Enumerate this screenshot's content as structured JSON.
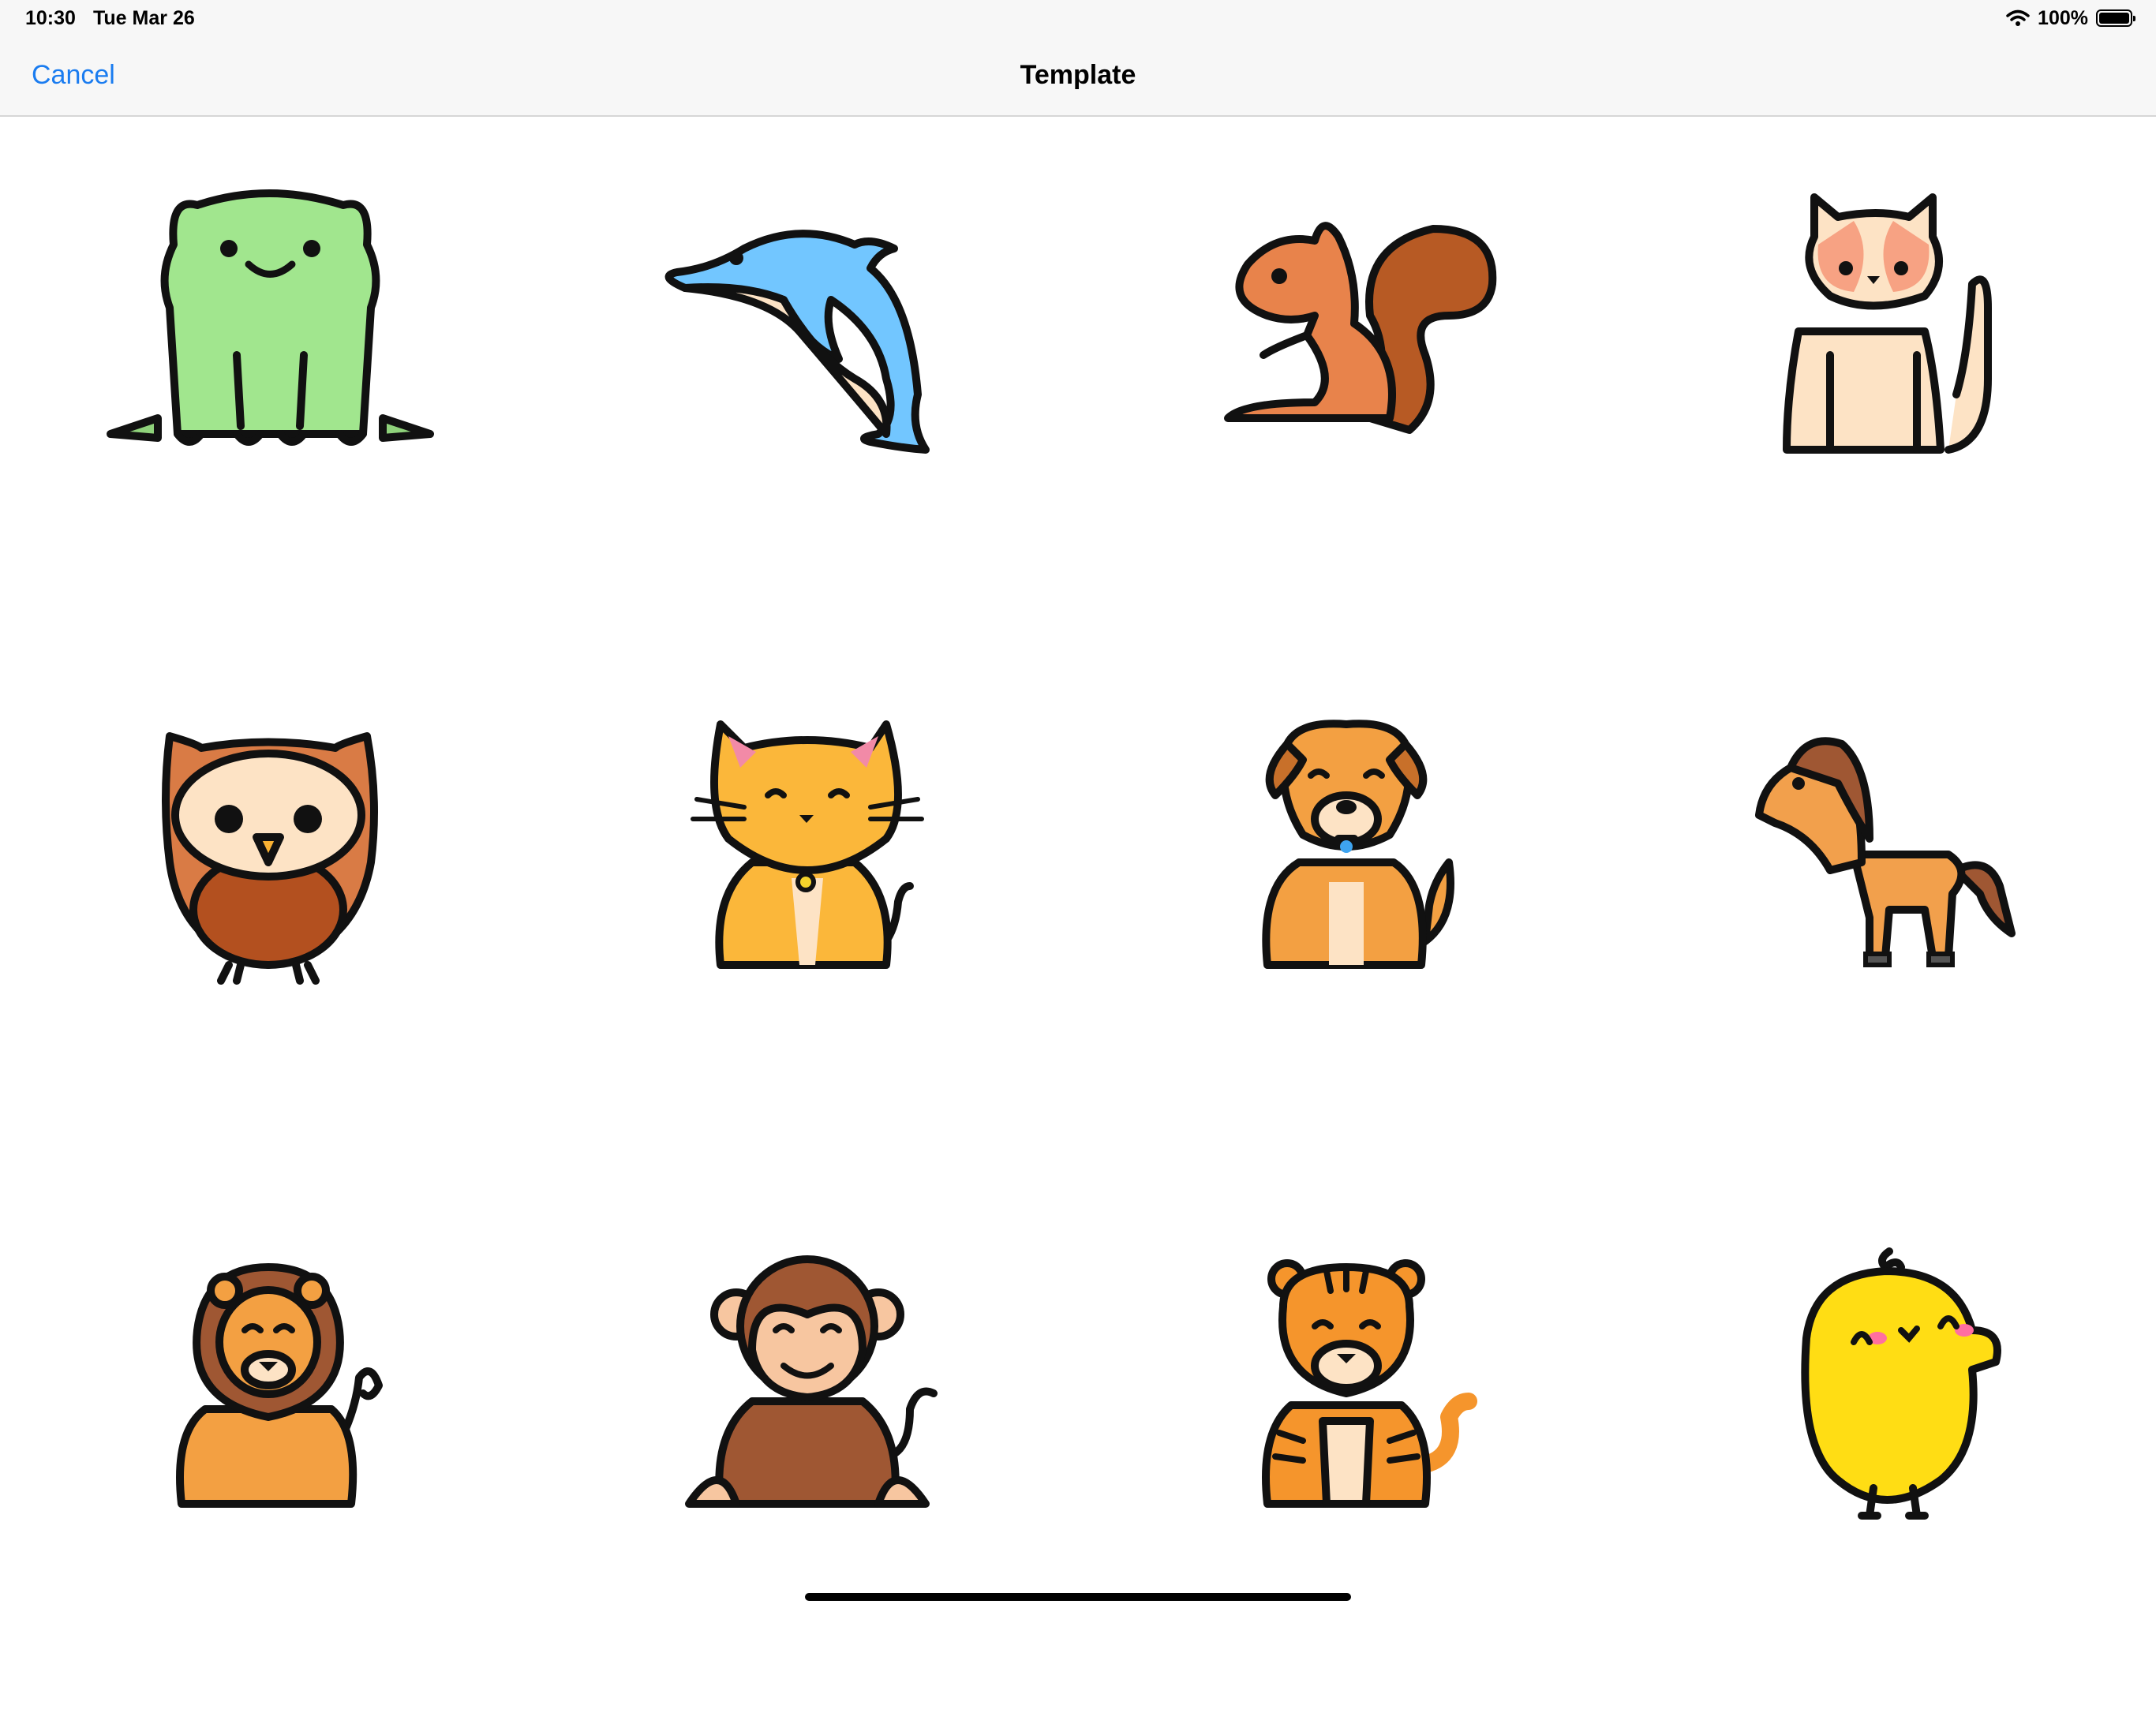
{
  "status_bar": {
    "time": "10:30",
    "date": "Tue Mar 26",
    "battery": "100%"
  },
  "nav": {
    "cancel": "Cancel",
    "title": "Template"
  },
  "templates": [
    {
      "name": "frog",
      "color": "#a1e68e"
    },
    {
      "name": "dolphin",
      "color": "#72c6ff"
    },
    {
      "name": "squirrel",
      "color": "#e8834b"
    },
    {
      "name": "cat",
      "color": "#fde3c5"
    },
    {
      "name": "owl",
      "color": "#d97b45"
    },
    {
      "name": "kitten",
      "color": "#fbb73a"
    },
    {
      "name": "dog",
      "color": "#f3a042"
    },
    {
      "name": "horse",
      "color": "#f2a04c"
    },
    {
      "name": "lion",
      "color": "#f3a042"
    },
    {
      "name": "monkey",
      "color": "#9f5733"
    },
    {
      "name": "tiger",
      "color": "#f5952c"
    },
    {
      "name": "chick",
      "color": "#ffdd14"
    }
  ]
}
